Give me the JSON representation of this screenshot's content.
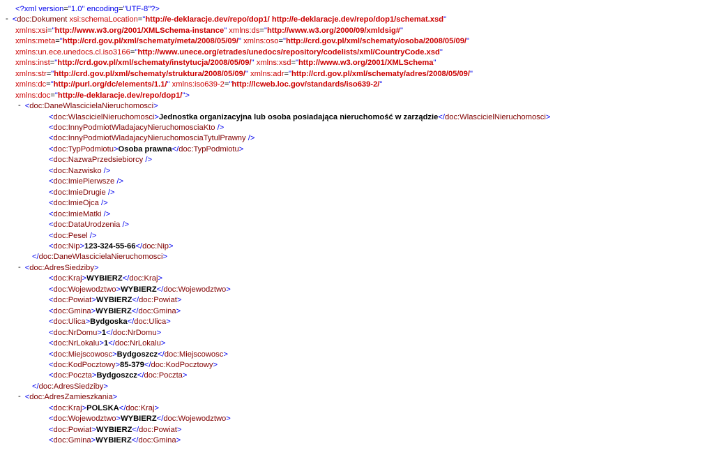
{
  "xmlDecl": "<?xml version=\"1.0\" encoding=\"UTF-8\"?>",
  "root": {
    "tag": "doc:Dokument",
    "attrs": [
      {
        "n": "xsi:schemaLocation",
        "v": "http://e-deklaracje.dev/repo/dop1/ http://e-deklaracje.dev/repo/dop1/schemat.xsd",
        "trail": ""
      },
      {
        "n": "xmlns:xsi",
        "v": "http://www.w3.org/2001/XMLSchema-instance",
        "trail": " "
      },
      {
        "n": "xmlns:ds",
        "v": "http://www.w3.org/2000/09/xmldsig#",
        "trail": ""
      },
      {
        "n": "xmlns:meta",
        "v": "http://crd.gov.pl/xml/schematy/meta/2008/05/09/",
        "trail": " "
      },
      {
        "n": "xmlns:oso",
        "v": "http://crd.gov.pl/xml/schematy/osoba/2008/05/09/",
        "trail": ""
      },
      {
        "n": "xmlns:un.ece.unedocs.cl.iso3166",
        "v": "http://www.unece.org/etrades/unedocs/repository/codelists/xml/CountryCode.xsd",
        "trail": ""
      },
      {
        "n": "xmlns:inst",
        "v": "http://crd.gov.pl/xml/schematy/instytucja/2008/05/09/",
        "trail": " "
      },
      {
        "n": "xmlns:xsd",
        "v": "http://www.w3.org/2001/XMLSchema",
        "trail": ""
      },
      {
        "n": "xmlns:str",
        "v": "http://crd.gov.pl/xml/schematy/struktura/2008/05/09/",
        "trail": " "
      },
      {
        "n": "xmlns:adr",
        "v": "http://crd.gov.pl/xml/schematy/adres/2008/05/09/",
        "trail": ""
      },
      {
        "n": "xmlns:dc",
        "v": "http://purl.org/dc/elements/1.1/",
        "trail": " "
      },
      {
        "n": "xmlns:iso639-2",
        "v": "http://lcweb.loc.gov/standards/iso639-2/",
        "trail": ""
      },
      {
        "n": "xmlns:doc",
        "v": "http://e-deklaracje.dev/repo/dop1/",
        "trail": ""
      }
    ]
  },
  "blocks": [
    {
      "open": "doc:DaneWlascicielaNieruchomosci",
      "close": "doc:DaneWlascicielaNieruchomosci",
      "children": [
        {
          "tag": "doc:WlascicielNieruchomosci",
          "text": "Jednostka organizacyjna lub osoba posiadająca nieruchomość w zarządzie"
        },
        {
          "tag": "doc:InnyPodmiotWladajacyNieruchomosciaKto",
          "self": true
        },
        {
          "tag": "doc:InnyPodmiotWladajacyNieruchomosciaTytulPrawny",
          "self": true
        },
        {
          "tag": "doc:TypPodmiotu",
          "text": "Osoba prawna"
        },
        {
          "tag": "doc:NazwaPrzedsiebiorcy",
          "self": true
        },
        {
          "tag": "doc:Nazwisko",
          "self": true
        },
        {
          "tag": "doc:ImiePierwsze",
          "self": true
        },
        {
          "tag": "doc:ImieDrugie",
          "self": true
        },
        {
          "tag": "doc:ImieOjca",
          "self": true
        },
        {
          "tag": "doc:ImieMatki",
          "self": true
        },
        {
          "tag": "doc:DataUrodzenia",
          "self": true
        },
        {
          "tag": "doc:Pesel",
          "self": true
        },
        {
          "tag": "doc:Nip",
          "text": "123-324-55-66"
        }
      ]
    },
    {
      "open": "doc:AdresSiedziby",
      "close": "doc:AdresSiedziby",
      "children": [
        {
          "tag": "doc:Kraj",
          "text": "WYBIERZ"
        },
        {
          "tag": "doc:Wojewodztwo",
          "text": "WYBIERZ"
        },
        {
          "tag": "doc:Powiat",
          "text": "WYBIERZ"
        },
        {
          "tag": "doc:Gmina",
          "text": "WYBIERZ"
        },
        {
          "tag": "doc:Ulica",
          "text": "Bydgoska"
        },
        {
          "tag": "doc:NrDomu",
          "text": "1"
        },
        {
          "tag": "doc:NrLokalu",
          "text": "1"
        },
        {
          "tag": "doc:Miejscowosc",
          "text": "Bydgoszcz"
        },
        {
          "tag": "doc:KodPocztowy",
          "text": "85-379"
        },
        {
          "tag": "doc:Poczta",
          "text": "Bydgoszcz"
        }
      ]
    },
    {
      "open": "doc:AdresZamieszkania",
      "close": null,
      "children": [
        {
          "tag": "doc:Kraj",
          "text": "POLSKA"
        },
        {
          "tag": "doc:Wojewodztwo",
          "text": "WYBIERZ"
        },
        {
          "tag": "doc:Powiat",
          "text": "WYBIERZ"
        },
        {
          "tag": "doc:Gmina",
          "text": "WYBIERZ"
        }
      ]
    }
  ]
}
